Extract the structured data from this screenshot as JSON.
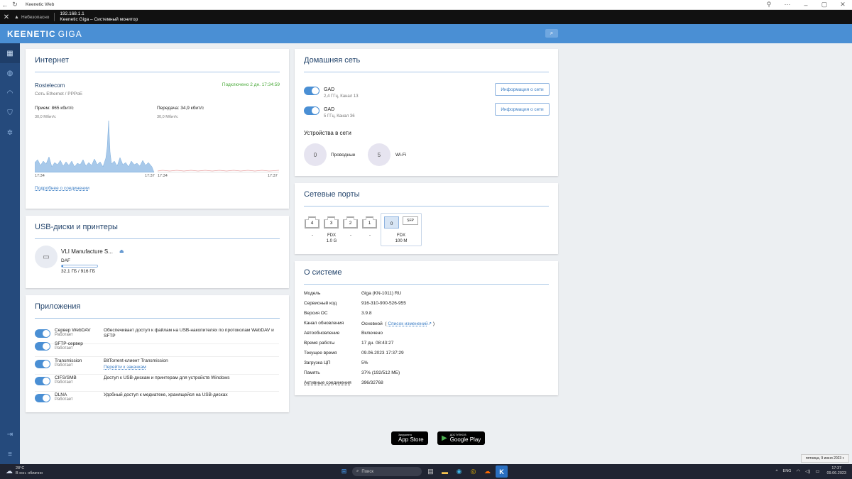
{
  "browser": {
    "window_title": "Keenetic Web",
    "insecure_label": "Небезопасно",
    "url": "192.168.1.1",
    "page_title": "Keenetic Giga – Системный монитор"
  },
  "header": {
    "logo_brand": "KEENETIC",
    "logo_model": "GIGA"
  },
  "internet": {
    "title": "Интернет",
    "provider": "Rostelecom",
    "connection_type": "Сеть Ethernet / PPPoE",
    "status": "Подключено 2 дн. 17:34:59",
    "rx_label": "Прием: 865 кбит/с",
    "tx_label": "Передача: 34,9 кбит/с",
    "rx_scale": "30,0 Мбит/с",
    "tx_scale": "30,0 Мбит/с",
    "rx_time_start": "17:34",
    "rx_time_end": "17:37",
    "tx_time_start": "17:34",
    "tx_time_end": "17:37",
    "details_link": "Подробнее о соединении"
  },
  "usb": {
    "title": "USB-диски и принтеры",
    "disk_name": "VLI Manufacture S...",
    "filesystem": "DAF",
    "usage_fraction": 0.035,
    "size": "32,1 ГБ / 916 ГБ"
  },
  "apps": {
    "title": "Приложения",
    "items": [
      {
        "name": "Сервер WebDAV",
        "status": "Работает",
        "desc": "Обеспечивает доступ к файлам на USB-накопителях по протоколам WebDAV и SFTP",
        "link": ""
      },
      {
        "name": "SFTP-сервер",
        "status": "Работает",
        "desc": "",
        "link": ""
      },
      {
        "name": "Transmission",
        "status": "Работает",
        "desc": "BitTorrent-клиент Transmission",
        "link": "Перейти к закачкам"
      },
      {
        "name": "CIFS/SMB",
        "status": "Работает",
        "desc": "Доступ к USB-дискам и принтерам для устройств Windows",
        "link": ""
      },
      {
        "name": "DLNA",
        "status": "Работает",
        "desc": "Удобный доступ к медиатеке, хранящейся на USB-дисках",
        "link": ""
      }
    ]
  },
  "home": {
    "title": "Домашняя сеть",
    "networks": [
      {
        "name": "GAD",
        "band": "2,4 ГГц, Канал 13",
        "button": "Информация о сети"
      },
      {
        "name": "GAD",
        "band": "5 ГГц, Канал 36",
        "button": "Информация о сети"
      }
    ],
    "devices_title": "Устройства в сети",
    "wired_count": "0",
    "wired_label": "Проводные",
    "wifi_count": "5",
    "wifi_label": "Wi-Fi"
  },
  "ports": {
    "title": "Сетевые порты",
    "items": [
      {
        "num": "4",
        "status": "-"
      },
      {
        "num": "3",
        "status": "FDX\n1.0 G"
      },
      {
        "num": "2",
        "status": "-"
      },
      {
        "num": "1",
        "status": "-"
      }
    ],
    "wan": {
      "num": "0",
      "sfp": "SFP",
      "status_line1": "FDX",
      "status_line2": "100 M"
    }
  },
  "about": {
    "title": "О системе",
    "rows": [
      {
        "label": "Модель",
        "value": "Giga (KN-1011) RU"
      },
      {
        "label": "Сервисный код",
        "value": "916-310-900-526-955"
      },
      {
        "label": "Версия ОС",
        "value": "3.9.8"
      },
      {
        "label": "Канал обновления",
        "value": "Основной"
      },
      {
        "label": "Автообновление",
        "value": "Включено"
      },
      {
        "label": "Время работы",
        "value": "17 дн. 08:43:27"
      },
      {
        "label": "Текущее время",
        "value": "09.06.2023 17:37:29"
      },
      {
        "label": "Загрузка ЦП",
        "value": "5%"
      },
      {
        "label": "Память",
        "value": "37% (192/512 МБ)"
      },
      {
        "label": "Активные соединения",
        "value": "396/32768"
      }
    ],
    "changelog_link": "Список изменений"
  },
  "stores": {
    "appstore_small": "Загрузите в",
    "appstore_big": "App Store",
    "gplay_small": "ДОСТУПНО В",
    "gplay_big": "Google Play"
  },
  "tooltip": "пятница, 9 июня 2023 г.",
  "taskbar": {
    "temp": "28°C",
    "weather": "В осн. облачно",
    "search": "Поиск",
    "lang": "ENG",
    "time": "17:37",
    "date": "09.06.2023"
  }
}
